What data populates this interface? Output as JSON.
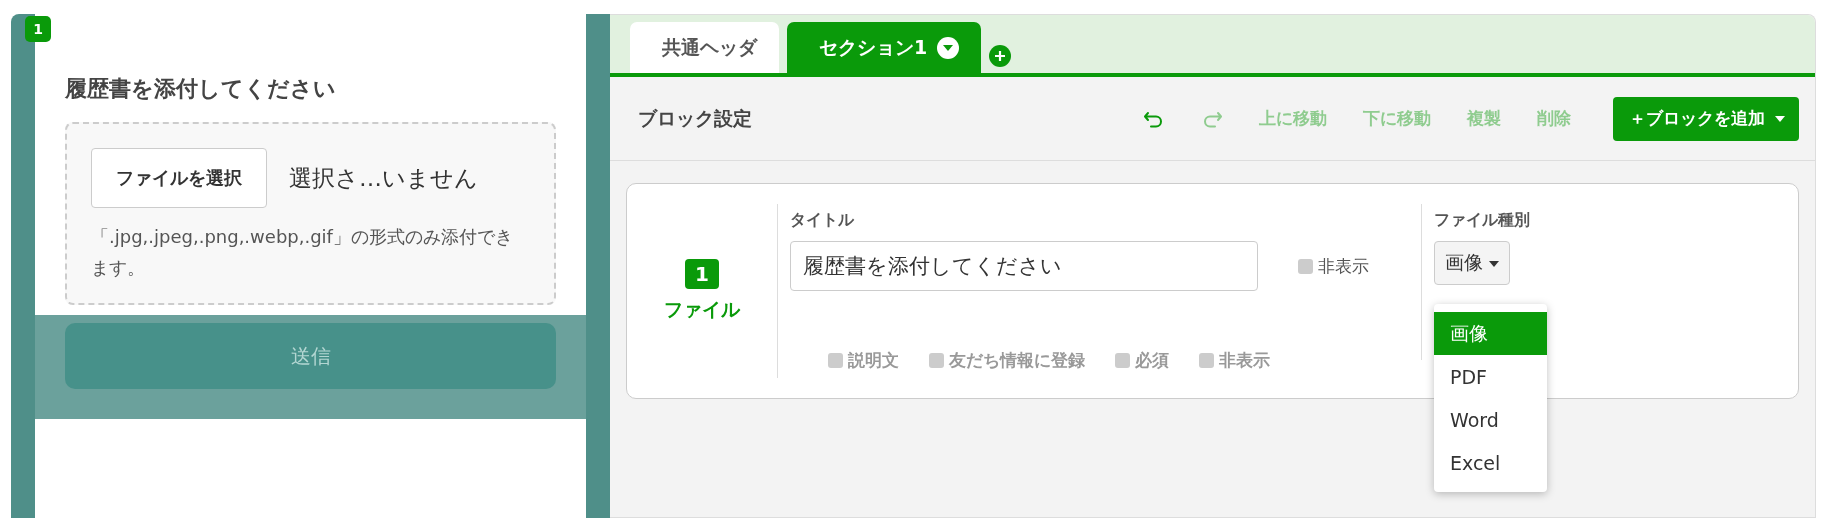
{
  "preview": {
    "badge": "1",
    "title": "履歴書を添付してください",
    "file_button": "ファイルを選択",
    "file_status": "選択さ…いません",
    "hint": "「.jpg,.jpeg,.png,.webp,.gif」の形式のみ添付できます。",
    "submit": {
      "label": "送信",
      "disabled": true
    }
  },
  "tabs": [
    {
      "label": "共通ヘッダ",
      "selected": false,
      "has_menu": false
    },
    {
      "label": "セクション1",
      "selected": true,
      "has_menu": true
    }
  ],
  "toolbar": {
    "title": "ブロック設定",
    "actions": [
      {
        "kind": "undo",
        "disabled": false
      },
      {
        "kind": "redo",
        "disabled": true
      },
      {
        "kind": "text",
        "label": "上に移動",
        "disabled": true
      },
      {
        "kind": "text",
        "label": "下に移動",
        "disabled": true
      },
      {
        "kind": "text",
        "label": "複製",
        "disabled": true
      },
      {
        "kind": "text",
        "label": "削除",
        "disabled": true
      }
    ],
    "add_button": "＋ブロックを追加"
  },
  "block": {
    "number": "1",
    "type_label": "ファイル",
    "title_label": "タイトル",
    "title_value": "履歴書を添付してください",
    "hide_title": {
      "label": "非表示",
      "checked": false,
      "disabled": false
    },
    "options": [
      {
        "label": "説明文",
        "checked": false,
        "disabled": true
      },
      {
        "label": "友だち情報に登録",
        "checked": false,
        "disabled": true
      },
      {
        "label": "必須",
        "checked": false,
        "disabled": true
      },
      {
        "label": "非表示",
        "checked": false,
        "disabled": true
      }
    ],
    "file_type": {
      "label": "ファイル種別",
      "value": "画像",
      "expanded": true,
      "options": [
        {
          "label": "画像",
          "selected": true
        },
        {
          "label": "PDF",
          "selected": false
        },
        {
          "label": "Word",
          "selected": false
        },
        {
          "label": "Excel",
          "selected": false
        }
      ]
    }
  }
}
